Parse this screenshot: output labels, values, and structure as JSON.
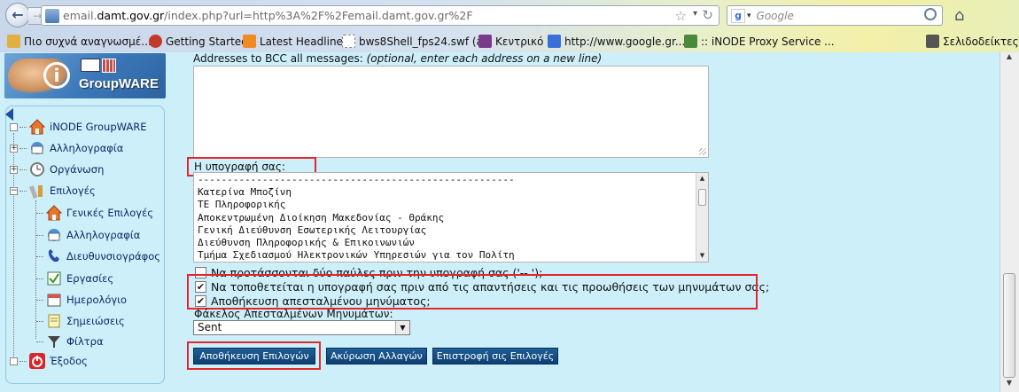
{
  "browser": {
    "url_prefix": "email.",
    "url_domain": "damt.gov.gr",
    "url_path": "/index.php?url=http%3A%2F%2Femail.damt.gov.gr%2F",
    "search_placeholder": "Google",
    "search_engine_letter": "g",
    "bookmarks": [
      {
        "label": "Πιο συχνά αναγνωσμέ...",
        "icon": "folder-icon"
      },
      {
        "label": "Getting Started",
        "icon": "firefox-icon"
      },
      {
        "label": "Latest Headlines",
        "icon": "rss-icon"
      },
      {
        "label": "bws8Shell_fps24.swf (a...",
        "icon": "page-icon"
      },
      {
        "label": "Κεντρικό",
        "icon": "bird-icon"
      },
      {
        "label": "http://www.google.gr...",
        "icon": "google-icon"
      },
      {
        "label": ":: iNODE Proxy Service ...",
        "icon": "tree-icon"
      },
      {
        "label": "Σελιδοδείκτες",
        "icon": "bookmarks-icon"
      }
    ]
  },
  "logo": {
    "text": "GroupWARE",
    "letter": "i"
  },
  "sidebar": {
    "items": [
      {
        "label": "iNODE GroupWARE",
        "icon": "home-icon"
      },
      {
        "label": "Αλληλογραφία",
        "icon": "mail-icon"
      },
      {
        "label": "Οργάνωση",
        "icon": "clock-icon"
      },
      {
        "label": "Επιλογές",
        "icon": "tools-icon"
      },
      {
        "label": "Γενικές Επιλογές",
        "icon": "home-icon"
      },
      {
        "label": "Αλληλογραφία",
        "icon": "mail-icon"
      },
      {
        "label": "Διευθυνσιογράφος",
        "icon": "phone-icon"
      },
      {
        "label": "Εργασίες",
        "icon": "tasks-icon"
      },
      {
        "label": "Ημερολόγιο",
        "icon": "calendar-icon"
      },
      {
        "label": "Σημειώσεις",
        "icon": "notes-icon"
      },
      {
        "label": "Φίλτρα",
        "icon": "filter-icon"
      },
      {
        "label": "Έξοδος",
        "icon": "power-icon"
      }
    ]
  },
  "form": {
    "bcc_label": "Addresses to BCC all messages:",
    "bcc_hint": "(optional, enter each address on a new line)",
    "bcc_value": "",
    "signature_label": "Η υπογραφή σας:",
    "signature_lines": [
      "------------------------------------------------------",
      "Κατερίνα Μποζίνη",
      "ΤΕ Πληροφορικής",
      "Αποκεντρωμένη Διοίκηση Μακεδονίας - Θράκης",
      "Γενική Διεύθυνση Εσωτερικής Λειτουργίας",
      "Διεύθυνση Πληροφορικής & Επικοινωνιών",
      "Τμήμα Σχεδιασμού Ηλεκτρονικών Υπηρεσιών για τον Πολίτη"
    ],
    "checkbox_dashes": {
      "label": "Να προτάσσονται δύο παύλες πριν την υπογραφή σας ('-- ');",
      "checked": false
    },
    "checkbox_sig_before_reply": {
      "label": "Να τοποθετείται η υπογραφή σας πριν από τις απαντήσεις και τις προωθήσεις των μηνυμάτων σας;",
      "checked": true
    },
    "checkbox_save_sent": {
      "label": "Αποθήκευση απεσταλμένου μηνύματος;",
      "checked": true
    },
    "sent_folder_label": "Φάκελος Απεσταλμένων Μηνυμάτων:",
    "sent_folder_value": "Sent",
    "buttons": {
      "save": "Αποθήκευση Επιλογών",
      "undo": "Ακύρωση Αλλαγών",
      "back": "Επιστροφή σις Επιλογές"
    }
  },
  "colors": {
    "page_bg": "#cdeffa",
    "button_bg": "#0d3f73",
    "highlight": "#e3262d"
  }
}
